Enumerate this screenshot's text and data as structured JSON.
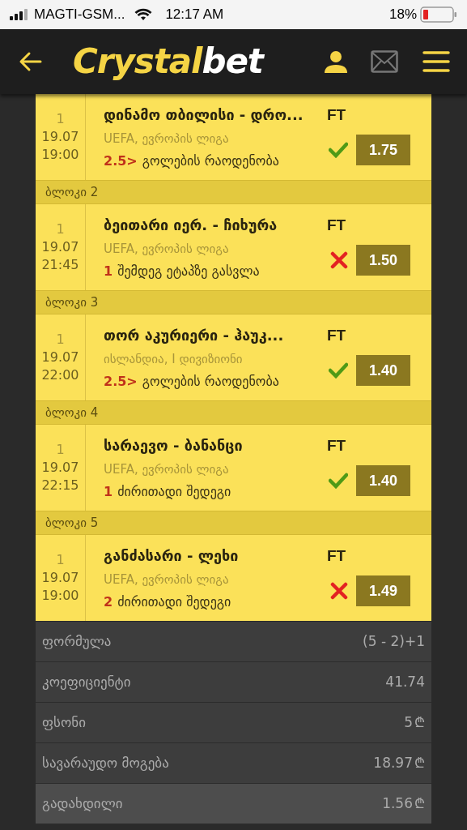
{
  "status_bar": {
    "carrier": "MAGTI-GSM...",
    "time": "12:17 AM",
    "battery": "18%"
  },
  "header": {
    "logo_main": "Crystal",
    "logo_accent": "bet"
  },
  "bets": [
    {
      "count": "1",
      "date": "19.07",
      "time": "19:00",
      "match": "დინამო თბილისი - დრო...",
      "status": "FT",
      "league": "UEFA, ევროპის ლიგა",
      "pick": "2.5>",
      "market": "გოლების რაოდენობა",
      "won": true,
      "odds": "1.75"
    },
    {
      "block": "ბლოკი 2",
      "count": "1",
      "date": "19.07",
      "time": "21:45",
      "match": "ბეითარი იერ. - ჩიხურა",
      "status": "FT",
      "league": "UEFA, ევროპის ლიგა",
      "pick": "1",
      "market": "შემდეგ ეტაპზე გასვლა",
      "won": false,
      "odds": "1.50"
    },
    {
      "block": "ბლოკი 3",
      "count": "1",
      "date": "19.07",
      "time": "22:00",
      "match": "თორ აკურიერი - ჰაუკ...",
      "status": "FT",
      "league": "ისლანდია, I დივიზიონი",
      "pick": "2.5>",
      "market": "გოლების რაოდენობა",
      "won": true,
      "odds": "1.40"
    },
    {
      "block": "ბლოკი 4",
      "count": "1",
      "date": "19.07",
      "time": "22:15",
      "match": "სარაევო - ბანანცი",
      "status": "FT",
      "league": "UEFA, ევროპის ლიგა",
      "pick": "1",
      "market": "ძირითადი შედეგი",
      "won": true,
      "odds": "1.40"
    },
    {
      "block": "ბლოკი 5",
      "count": "1",
      "date": "19.07",
      "time": "19:00",
      "match": "განძასარი - ლეხი",
      "status": "FT",
      "league": "UEFA, ევროპის ლიგა",
      "pick": "2",
      "market": "ძირითადი შედეგი",
      "won": false,
      "odds": "1.49"
    }
  ],
  "summary": [
    {
      "label": "ფორმულა",
      "value": "(5 - 2)+1",
      "selected": false
    },
    {
      "label": "კოეფიციენტი",
      "value": "41.74",
      "selected": false
    },
    {
      "label": "ფსონი",
      "value": "5",
      "currency": "₾",
      "selected": false
    },
    {
      "label": "სავარაუდო მოგება",
      "value": "18.97",
      "currency": "₾",
      "selected": false
    },
    {
      "label": "გადახდილი",
      "value": "1.56",
      "currency": "₾",
      "selected": true
    }
  ]
}
